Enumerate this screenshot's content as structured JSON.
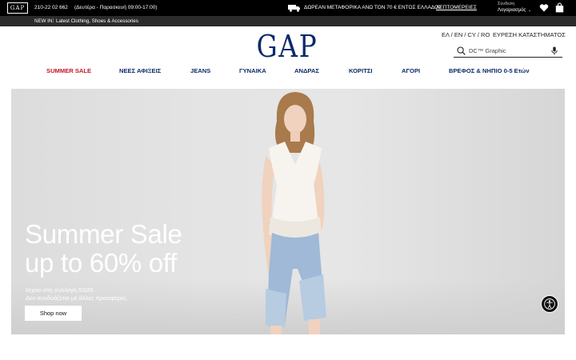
{
  "topbar": {
    "logo": "GAP",
    "phone": "210-22 02 662",
    "hours": "(Δευτέρα - Παρασκευή 09:00-17:00)",
    "shipping": "ΔΩΡΕΑΝ ΜΕΤΑΦΟΡΙΚΑ ΑΝΩ ΤΟΝ 70 € ΕΝΤΟΣ ΕΛΛΑΔΟΣ",
    "details": "ΛΕΠΤΟΜΕΡΕΙΕΣ",
    "signin": "Σύνδεση",
    "account": "Λογαριασμός",
    "icons": [
      "truck-icon",
      "chevron-down-icon",
      "heart-icon",
      "bag-icon"
    ]
  },
  "newbar": {
    "new_in": "NEW IN",
    "separator": "|",
    "latest": "Latest Clothing, Shoes & Accessories"
  },
  "header": {
    "logo": "GAP",
    "languages": "ΕΛ / EN / CY / RO",
    "store_finder": "ΕΥΡΕΣΗ ΚΑΤΑΣΤΗΜΑΤΟΣ",
    "search": {
      "placeholder": "DC™ Graphic"
    }
  },
  "nav": {
    "items": [
      "SUMMER SALE",
      "ΝΕΕΣ ΑΦΙΞΕΙΣ",
      "JEANS",
      "ΓΥΝΑΙΚΑ",
      "ΑΝΔΡΑΣ",
      "ΚΟΡΙΤΣΙ",
      "ΑΓΟΡΙ",
      "ΒΡΕΦΟΣ & ΝΗΠΙΟ 0-5 Ετών"
    ]
  },
  "hero": {
    "headline_line1": "Summer Sale",
    "headline_line2": "up to 60% off",
    "sub_line1": "Ισχύει στη συλλογή SS26.",
    "sub_line2": "Δεν συνδυάζεται με άλλες προσφορές.",
    "cta": "Shop now"
  },
  "colors": {
    "brand_navy": "#0b2a6b",
    "sale_red": "#c0182a",
    "topbar": "#000000",
    "newbar": "#2b2b2b"
  }
}
